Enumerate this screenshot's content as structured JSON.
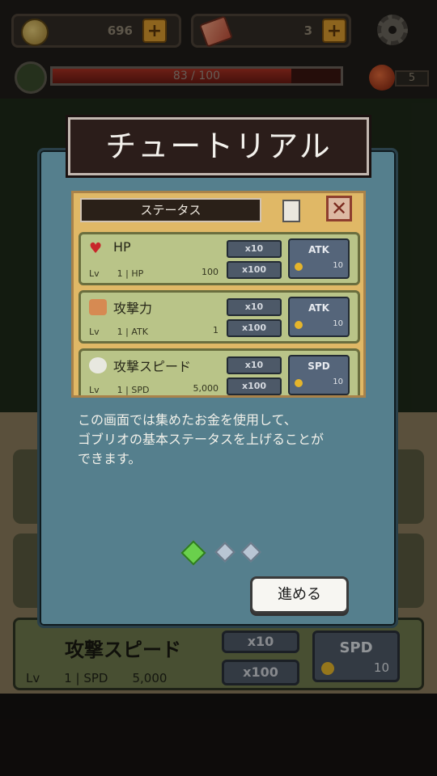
{
  "hud": {
    "coins": "696",
    "gems": "3",
    "hp_text": "83 / 100",
    "hp_fraction": 0.83,
    "potions": "5"
  },
  "background": {
    "card3": {
      "title": "攻撃スピード",
      "lv": "Lv　　1 | SPD　　5,000",
      "btn_x10": "x10",
      "btn_x100": "x100",
      "upgrade_label": "SPD",
      "upgrade_cost": "10"
    }
  },
  "dialog": {
    "title": "チュートリアル",
    "description_line1": "この画面では集めたお金を使用して、",
    "description_line2": "ゴブリオの基本ステータスを上げることが",
    "description_line3": "できます。",
    "next_label": "進める",
    "page_indicator": {
      "current": 1,
      "total": 3
    }
  },
  "status_preview": {
    "header": "ステータス",
    "cards": [
      {
        "name": "HP",
        "lv": "Lv　　1 | HP",
        "value": "100",
        "btn1": "x10",
        "btn2": "x100",
        "upgrade": "ATK",
        "cost": "10"
      },
      {
        "name": "攻撃力",
        "lv": "Lv　　1 | ATK",
        "value": "1",
        "btn1": "x10",
        "btn2": "x100",
        "upgrade": "ATK",
        "cost": "10"
      },
      {
        "name": "攻撃スピード",
        "lv": "Lv　　1 | SPD",
        "value": "5,000",
        "btn1": "x10",
        "btn2": "x100",
        "upgrade": "SPD",
        "cost": "10"
      }
    ]
  },
  "colors": {
    "dialog_bg": "#557f8d",
    "title_bg": "#2b1d1a",
    "card_bg": "#b9c488",
    "accent_plus": "#d99a2e"
  }
}
